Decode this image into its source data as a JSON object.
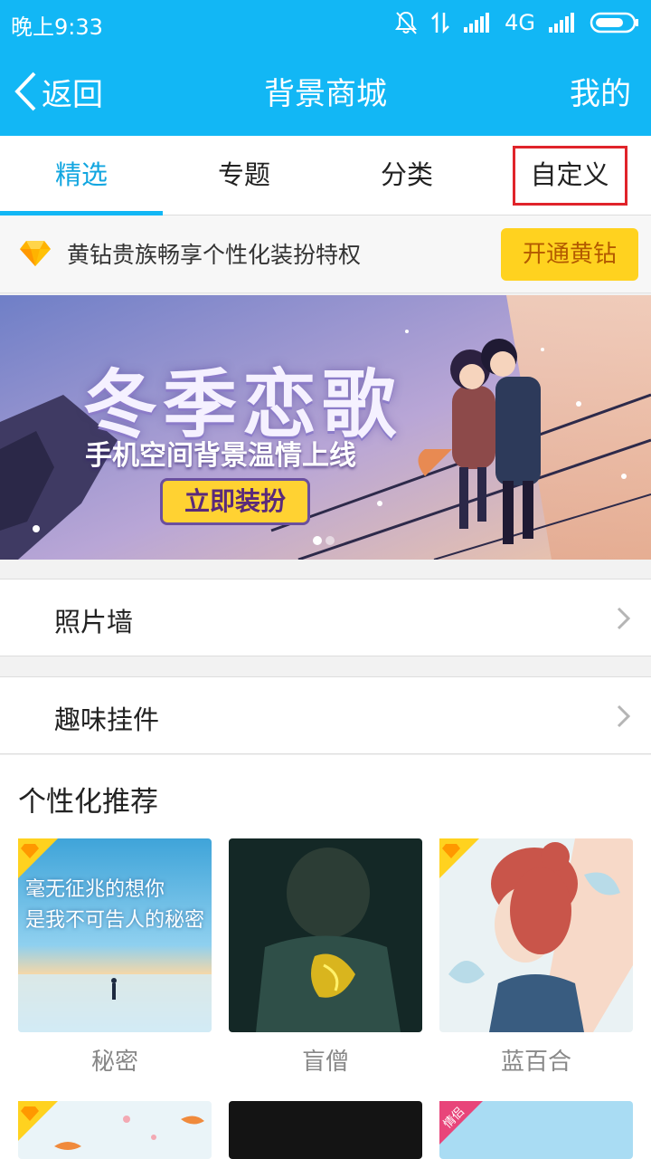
{
  "status": {
    "time": "晚上9:33",
    "network": "4G"
  },
  "titlebar": {
    "back": "返回",
    "title": "背景商城",
    "mine": "我的"
  },
  "tabs": [
    {
      "label": "精选"
    },
    {
      "label": "专题"
    },
    {
      "label": "分类"
    },
    {
      "label": "自定义"
    }
  ],
  "vip": {
    "text": "黄钻贵族畅享个性化装扮特权",
    "button": "开通黄钻"
  },
  "banner": {
    "title": "冬季恋歌",
    "subtitle": "手机空间背景温情上线",
    "button": "立即装扮",
    "page_count": 2,
    "active_page": 1
  },
  "list": [
    {
      "label": "照片墙"
    },
    {
      "label": "趣味挂件"
    }
  ],
  "recommend": {
    "heading": "个性化推荐",
    "items": [
      {
        "name": "秘密",
        "overlay_line1": "毫无征兆的想你",
        "overlay_line2": "是我不可告人的秘密",
        "badge": "diamond-icon"
      },
      {
        "name": "盲僧",
        "badge": ""
      },
      {
        "name": "蓝百合",
        "badge": "diamond-icon"
      }
    ],
    "next_row": [
      {
        "badge": "diamond-icon"
      },
      {
        "badge": ""
      },
      {
        "badge": "情侣"
      }
    ]
  },
  "colors": {
    "primary": "#12b7f5",
    "active_tab": "#12a6e0",
    "highlight": "#e0242a",
    "vip_button": "#ffd21f",
    "vip_text": "#b35a00"
  }
}
